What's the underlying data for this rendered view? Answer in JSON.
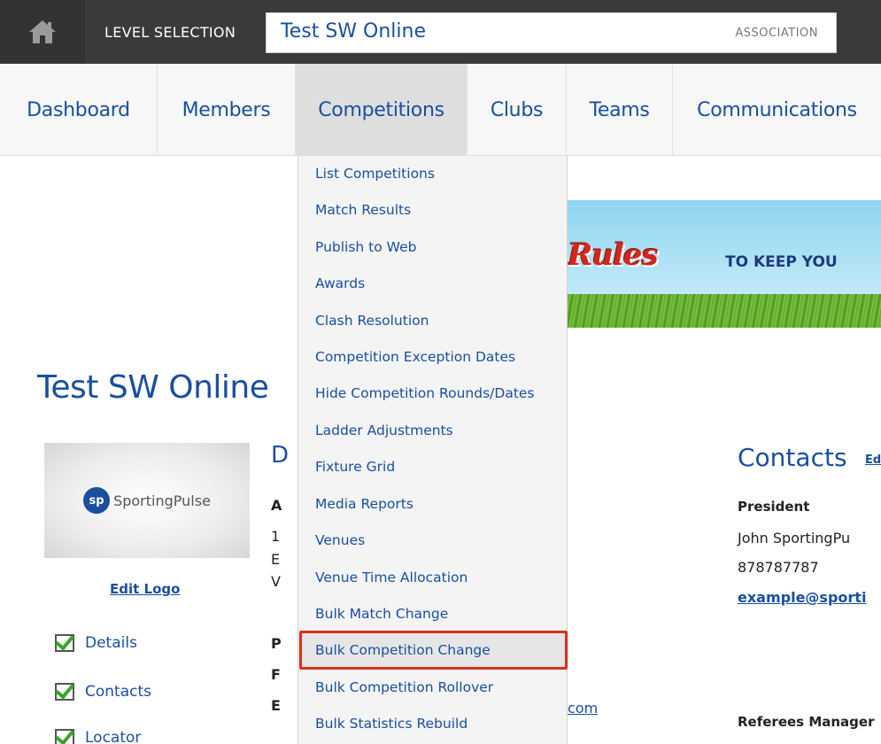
{
  "topbar": {
    "level_selection": "LEVEL SELECTION",
    "level_name": "Test SW Online",
    "level_type": "ASSOCIATION"
  },
  "nav": {
    "items": [
      {
        "label": "Dashboard"
      },
      {
        "label": "Members"
      },
      {
        "label": "Competitions",
        "active": true
      },
      {
        "label": "Clubs"
      },
      {
        "label": "Teams"
      },
      {
        "label": "Communications"
      }
    ]
  },
  "dropdown": {
    "items": [
      "List Competitions",
      "Match Results",
      "Publish to Web",
      "Awards",
      "Clash Resolution",
      "Competition Exception Dates",
      "Hide Competition Rounds/Dates",
      "Ladder Adjustments",
      "Fixture Grid",
      "Media Reports",
      "Venues",
      "Venue Time Allocation",
      "Bulk Match Change",
      "Bulk Competition Change",
      "Bulk Competition Rollover",
      "Bulk Statistics Rebuild"
    ],
    "highlighted": "Bulk Competition Change"
  },
  "banner": {
    "brand": "Rules",
    "tagline": "TO KEEP YOU"
  },
  "page": {
    "title": "Test SW Online",
    "logo_text": "SportingPulse",
    "logo_mark": "sp",
    "edit_logo": "Edit Logo",
    "checklist": [
      "Details",
      "Contacts",
      "Locator"
    ]
  },
  "details_fragments": {
    "heading": "D",
    "lines": [
      "A",
      "1",
      "E",
      "V",
      "P",
      "F",
      "E"
    ],
    "email_tail": "com"
  },
  "contacts": {
    "title": "Contacts",
    "edit": "Ed",
    "role": "President",
    "name": "John SportingPu",
    "phone": "878787787",
    "email": "example@sporti",
    "role2": "Referees Manager"
  }
}
